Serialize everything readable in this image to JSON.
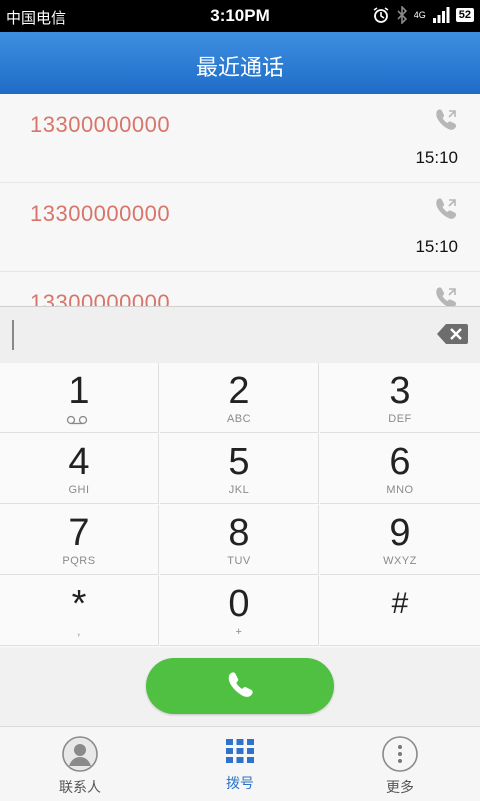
{
  "status_bar": {
    "carrier": "中国电信",
    "time": "3:10PM",
    "network": "4G",
    "battery": "52",
    "icons": [
      "alarm-icon",
      "bluetooth-icon",
      "signal-icon",
      "battery-icon"
    ]
  },
  "header": {
    "title": "最近通话"
  },
  "recent_calls": [
    {
      "number": "13300000000",
      "time": "15:10",
      "icon": "outgoing-call-icon"
    },
    {
      "number": "13300000000",
      "time": "15:10",
      "icon": "outgoing-call-icon"
    },
    {
      "number": "13300000000",
      "time": "",
      "icon": "outgoing-call-icon"
    }
  ],
  "dial_input": {
    "value": "",
    "backspace_icon": "backspace-icon"
  },
  "keypad": [
    {
      "digit": "1",
      "letters": "",
      "icon": "voicemail-icon"
    },
    {
      "digit": "2",
      "letters": "ABC"
    },
    {
      "digit": "3",
      "letters": "DEF"
    },
    {
      "digit": "4",
      "letters": "GHI"
    },
    {
      "digit": "5",
      "letters": "JKL"
    },
    {
      "digit": "6",
      "letters": "MNO"
    },
    {
      "digit": "7",
      "letters": "PQRS"
    },
    {
      "digit": "8",
      "letters": "TUV"
    },
    {
      "digit": "9",
      "letters": "WXYZ"
    },
    {
      "digit": "*",
      "letters": ","
    },
    {
      "digit": "0",
      "letters": "+"
    },
    {
      "digit": "#",
      "letters": ""
    }
  ],
  "call_button": {
    "icon": "phone-icon"
  },
  "tabs": [
    {
      "label": "联系人",
      "icon": "contact-icon",
      "active": false
    },
    {
      "label": "拨号",
      "icon": "dialpad-icon",
      "active": true
    },
    {
      "label": "更多",
      "icon": "more-icon",
      "active": false
    }
  ],
  "colors": {
    "header_blue": "#1f6cc8",
    "number_red": "#d8756a",
    "call_green": "#4fc041",
    "active_tab": "#2e72c9"
  }
}
